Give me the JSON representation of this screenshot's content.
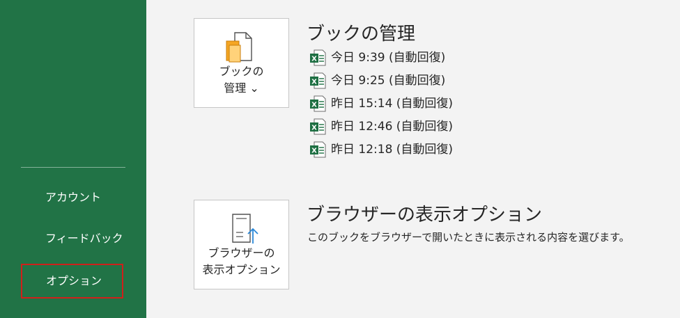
{
  "sidebar": {
    "items": [
      {
        "label": "アカウント"
      },
      {
        "label": "フィードバック"
      },
      {
        "label": "オプション",
        "selected": true
      }
    ]
  },
  "manage_workbook": {
    "title": "ブックの管理",
    "tile_label": "ブックの\n管理 ⌄",
    "versions": [
      {
        "label": "今日 9:39 (自動回復)"
      },
      {
        "label": "今日 9:25 (自動回復)"
      },
      {
        "label": "昨日 15:14 (自動回復)"
      },
      {
        "label": "昨日 12:46 (自動回復)"
      },
      {
        "label": "昨日 12:18 (自動回復)"
      }
    ]
  },
  "browser_view": {
    "title": "ブラウザーの表示オプション",
    "tile_label": "ブラウザーの\n表示オプション",
    "description": "このブックをブラウザーで開いたときに表示される内容を選びます。"
  },
  "colors": {
    "sidebar_bg": "#217346",
    "selected_border": "#d0201a",
    "content_bg": "#f3f3f3",
    "excel_green": "#1d6f42",
    "browser_arrow": "#2b88d8"
  },
  "icons": {
    "manage_tile": "manage-workbook-icon",
    "browser_tile": "browser-view-icon",
    "version": "excel-file-icon"
  }
}
